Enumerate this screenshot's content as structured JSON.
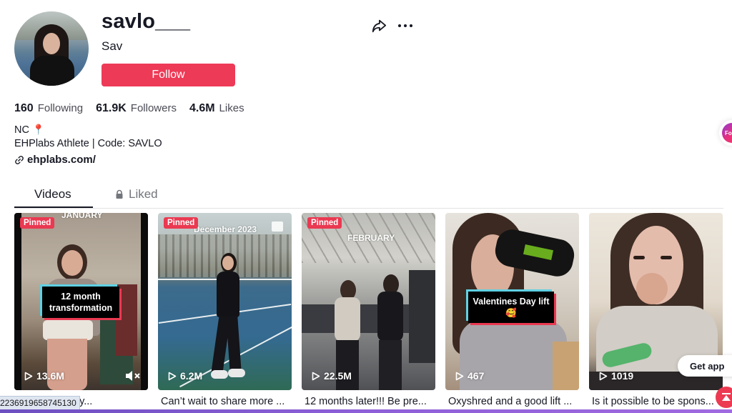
{
  "profile": {
    "username": "savlo___",
    "nickname": "Sav",
    "follow_label": "Follow",
    "stats": [
      {
        "value": "160",
        "label": "Following"
      },
      {
        "value": "61.9K",
        "label": "Followers"
      },
      {
        "value": "4.6M",
        "label": "Likes"
      }
    ],
    "bio_line1": "NC",
    "bio_pin": "📍",
    "bio_line2": "EHPlabs Athlete | Code: SAVLO",
    "link": "ehplabs.com/"
  },
  "tabs": [
    {
      "label": "Videos",
      "active": true
    },
    {
      "label": "Liked",
      "locked": true
    }
  ],
  "videos": [
    {
      "pinned": "Pinned",
      "overlay_top": "JANUARY",
      "caption_box": "12 month transformation",
      "views": "13.6M",
      "muted": true,
      "caption": "...sign to start y..."
    },
    {
      "pinned": "Pinned",
      "overlay_top": "December 2023",
      "photo": true,
      "views": "6.2M",
      "caption": "Can’t wait to share more ..."
    },
    {
      "pinned": "Pinned",
      "overlay_top": "FEBRUARY",
      "views": "22.5M",
      "caption": "12 months later!!! Be pre..."
    },
    {
      "caption_box": "Valentines Day lift🥰",
      "views": "467",
      "caption": "Oxyshred and a good lift ..."
    },
    {
      "views": "1019",
      "caption": "Is it possible to be spons..."
    }
  ],
  "floating": {
    "get_app": "Get app",
    "side_bubble": "Fo"
  },
  "status_bar": {
    "url_fragment": "2236919658745130"
  },
  "colors": {
    "accent": "#ed3a56",
    "text": "#161823"
  }
}
